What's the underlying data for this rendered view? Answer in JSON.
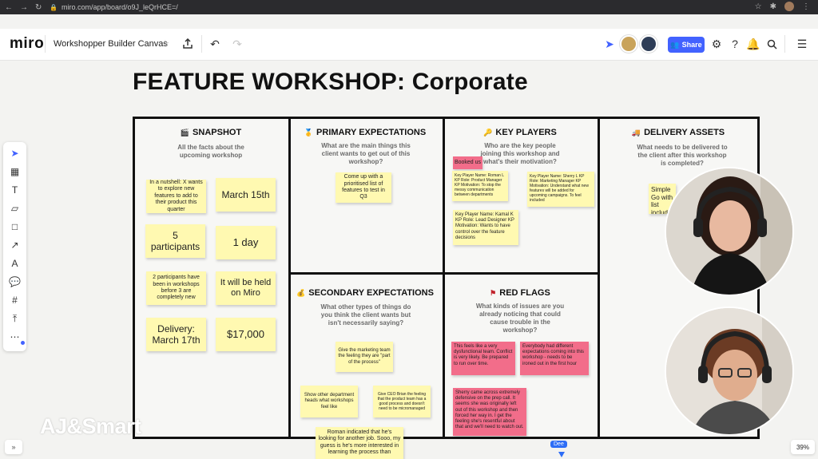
{
  "browser": {
    "url": "miro.com/app/board/o9J_leQrHCE=/"
  },
  "topbar": {
    "logo": "miro",
    "board_name": "Workshopper Builder Canvas",
    "share_label": "Share"
  },
  "canvas": {
    "title": "FEATURE WORKSHOP: Corporate"
  },
  "sections": {
    "snapshot": {
      "title": "SNAPSHOT",
      "subtitle": "All the facts about the upcoming workshop",
      "notes": [
        "In a nutshell: X wants to explore new features to add to their product this quarter",
        "March 15th",
        "5 participants",
        "1 day",
        "2 participants have been in workshops before 3 are completely new",
        "It will be held on Miro",
        "Delivery: March 17th",
        "$17,000"
      ]
    },
    "primary": {
      "title": "PRIMARY EXPECTATIONS",
      "subtitle": "What are the main things this client wants to get out of this workshop?",
      "notes": [
        "Come up with a prioritised list of features to test in Q3"
      ]
    },
    "players": {
      "title": "KEY PLAYERS",
      "subtitle": "Who are the key people joining this workshop and what's their motivation?",
      "booked_label": "Booked us",
      "notes": [
        "Key Player Name: Roman L KP Role: Product Manager KP Motivation: To stop the messy communication between departments",
        "Key Player Name: Sherry L KP Role: Marketing Manager KP Motivation: Understand what new features will be added for upcoming campaigns. To feel included",
        "Key Player Name: Kamal K KP Role: Lead Designer KP Motivation: Wants to have control over the feature decisions"
      ]
    },
    "delivery": {
      "title": "DELIVERY ASSETS",
      "subtitle": "What needs to be delivered to the client after this workshop is completed?",
      "notes": [
        "Simple Go with list includ"
      ]
    },
    "secondary": {
      "title": "SECONDARY EXPECTATIONS",
      "subtitle": "What other types of things do you think the client wants but isn't necessarily saying?",
      "notes": [
        "Give the marketing team the feeling they are \"part of the process\"",
        "Show other department heads what workshops feel like",
        "Give CEO Brian the feeling that the product team has a good process and doesn't need to be micromanaged",
        "Roman indicated that he's looking for another job. Sooo, my guess is he's more interested in learning the process than"
      ]
    },
    "redflags": {
      "title": "RED FLAGS",
      "subtitle": "What kinds of issues are you already noticing that could cause trouble in the workshop?",
      "notes": [
        "This feels like a very dysfunctional team. Conflict is very likely. Be prepared to run over time.",
        "Everybody had different expectations coming into this workshop - needs to be ironed out in the first hour",
        "Sherry came across extremely defensive on the prep call. It seems she was originally left out of this workshop and then forced her way in. I get the feeling she's resentful about that and we'll need to watch out."
      ]
    }
  },
  "overlay": {
    "watermark": "AJ&Smart",
    "zoom": "39%",
    "cursor_name": "Dee",
    "expand": "»"
  },
  "colors": {
    "accent": "#4262ff",
    "sticky_yellow": "#fff9b1",
    "sticky_pink": "#f26d8a"
  }
}
